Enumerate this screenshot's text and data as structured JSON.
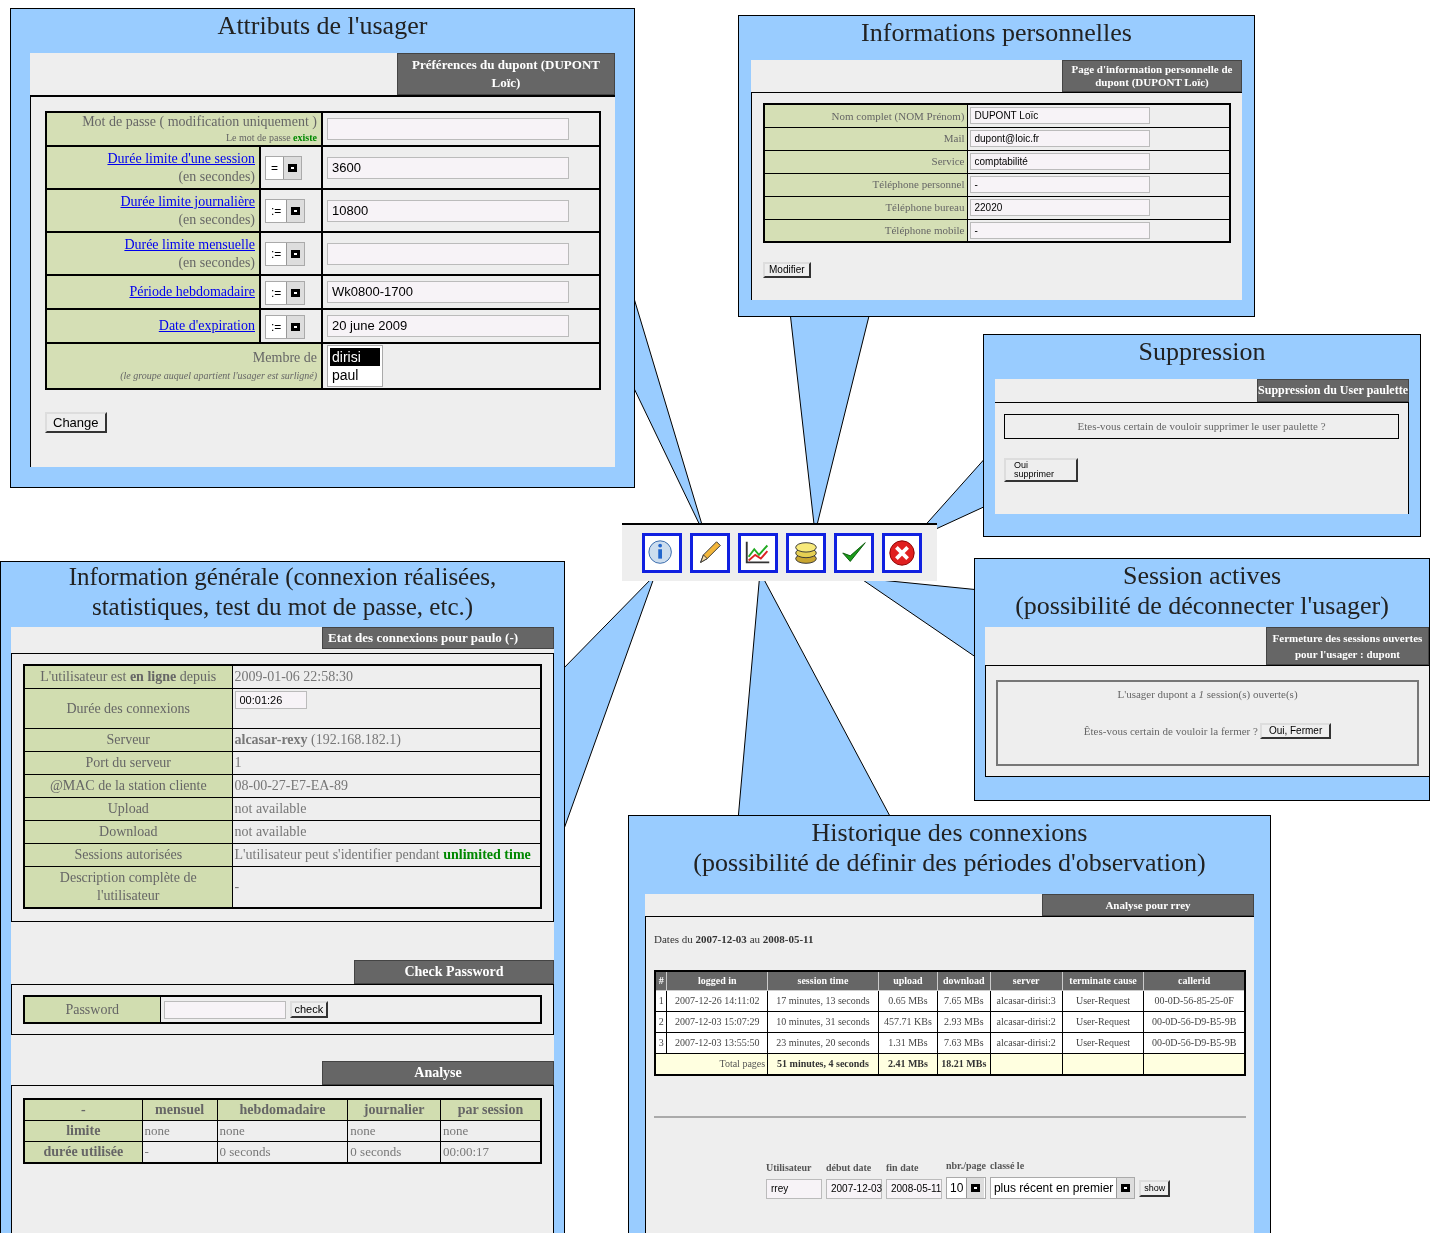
{
  "attributes": {
    "title": "Attributs de l'usager",
    "header": "Préférences du dupont (DUPONT Loïc)",
    "password": {
      "label": "Mot de passe ( modification uniquement )",
      "note": "Le mot de passe",
      "note_status": "existe"
    },
    "rows": [
      {
        "label": "Durée limite d'une session",
        "unit": "(en secondes)",
        "operator": "=",
        "value": "3600"
      },
      {
        "label": "Durée limite journalière",
        "unit": "(en secondes)",
        "operator": ":=",
        "value": "10800"
      },
      {
        "label": "Durée limite mensuelle",
        "unit": "(en secondes)",
        "operator": ":="
      },
      {
        "label": "Période hebdomadaire",
        "operator": ":=",
        "value": "Wk0800-1700"
      },
      {
        "label": "Date d'expiration",
        "operator": ":=",
        "value": "20 june 2009"
      }
    ],
    "member": {
      "label": "Membre de",
      "note": "(le groupe auquel apartient l'usager est surligné)",
      "groups": [
        {
          "name": "dirisi",
          "selected": true
        },
        {
          "name": "paul",
          "selected": false
        }
      ]
    },
    "button": "Change"
  },
  "personal": {
    "title": "Informations personnelles",
    "header": "Page d'information personnelle de dupont (DUPONT Loïc)",
    "fields": [
      {
        "label": "Nom complet (NOM Prénom)",
        "value": "DUPONT Loïc"
      },
      {
        "label": "Mail",
        "value": "dupont@loic.fr"
      },
      {
        "label": "Service",
        "value": "comptabilité"
      },
      {
        "label": "Téléphone personnel",
        "value": "-"
      },
      {
        "label": "Téléphone bureau",
        "value": "22020"
      },
      {
        "label": "Téléphone mobile",
        "value": "-"
      }
    ],
    "button": "Modifier"
  },
  "deletion": {
    "title": "Suppression",
    "header": "Suppression du User paulette",
    "question": "Etes-vous certain de vouloir supprimer le user paulette ?",
    "button": "Oui supprimer"
  },
  "sessions": {
    "title": "Session actives",
    "subtitle": "(possibilité de déconnecter l'usager)",
    "header": "Fermeture des sessions ouvertes pour l'usager : dupont",
    "message": "L'usager dupont a *1* session(s) ouverte(s)",
    "question": "Êtes-vous certain de vouloir la fermer ?",
    "button": "Oui, Fermer"
  },
  "general": {
    "title": "Information générale (connexion réalisées, statistiques, test du mot de passe, etc.)",
    "header": "Etat des connexions pour paulo (-)",
    "rows": [
      {
        "kind": "text",
        "label": "L'utilisateur est **en ligne** depuis",
        "value": "2009-01-06 22:58:30"
      },
      {
        "kind": "field",
        "label": "Durée des connexions",
        "value": "00:01:26"
      },
      {
        "kind": "text",
        "label": "Serveur",
        "value": "**alcasar-rexy** (192.168.182.1)"
      },
      {
        "kind": "text",
        "label": "Port du serveur",
        "value": "1"
      },
      {
        "kind": "text",
        "label": "@MAC de la station cliente",
        "value": "08-00-27-E7-EA-89"
      },
      {
        "kind": "text",
        "label": "Upload",
        "value": "not available"
      },
      {
        "kind": "text",
        "label": "Download",
        "value": "not available"
      },
      {
        "kind": "highlight",
        "label": "Sessions autorisées",
        "value": "L'utilisateur peut s'identifier pendant",
        "highlight": "unlimited time"
      },
      {
        "kind": "text",
        "label": "Description complète de l'utilisateur",
        "value": "-"
      }
    ],
    "check": {
      "header": "Check Password",
      "label": "Password",
      "button": "check"
    },
    "analysis": {
      "header": "Analyse",
      "columns": [
        "-",
        "mensuel",
        "hebdomadaire",
        "journalier",
        "par session"
      ],
      "rows": [
        [
          "limite",
          "none",
          "none",
          "none",
          "none"
        ],
        [
          "durée utilisée",
          "-",
          "0 seconds",
          "0 seconds",
          "00:00:17"
        ]
      ]
    }
  },
  "history": {
    "title": "Historique des connexions",
    "subtitle": "(possibilité de définir des périodes d'observation)",
    "header": "Analyse pour rrey",
    "dates": "Dates du **2007-12-03** au **2008-05-11**",
    "columns": [
      "#",
      "logged in",
      "session time",
      "upload",
      "download",
      "server",
      "terminate cause",
      "callerid"
    ],
    "rows": [
      [
        "1",
        "2007-12-26 14:11:02",
        "17 minutes, 13 seconds",
        "0.65 MBs",
        "7.65 MBs",
        "alcasar-dirisi:3",
        "User-Request",
        "00-0D-56-85-25-0F"
      ],
      [
        "2",
        "2007-12-03 15:07:29",
        "10 minutes, 31 seconds",
        "457.71 KBs",
        "2.93 MBs",
        "alcasar-dirisi:2",
        "User-Request",
        "00-0D-56-D9-B5-9B"
      ],
      [
        "3",
        "2007-12-03 13:55:50",
        "23 minutes, 20 seconds",
        "1.31 MBs",
        "7.63 MBs",
        "alcasar-dirisi:2",
        "User-Request",
        "00-0D-56-D9-B5-9B"
      ]
    ],
    "totals": {
      "label": "Total pages",
      "session_time": "51 minutes, 4 seconds",
      "upload": "2.41 MBs",
      "download": "18.21 MBs"
    },
    "filters": [
      {
        "kind": "input",
        "label": "Utilisateur",
        "value": "rrey"
      },
      {
        "kind": "input",
        "label": "début date",
        "value": "2007-12-03"
      },
      {
        "kind": "input",
        "label": "fin date",
        "value": "2008-05-11"
      },
      {
        "kind": "select",
        "label": "nbr./page",
        "value": "10"
      },
      {
        "kind": "select",
        "label": "classé le",
        "value": "plus récent en premier"
      }
    ],
    "button": "show"
  }
}
